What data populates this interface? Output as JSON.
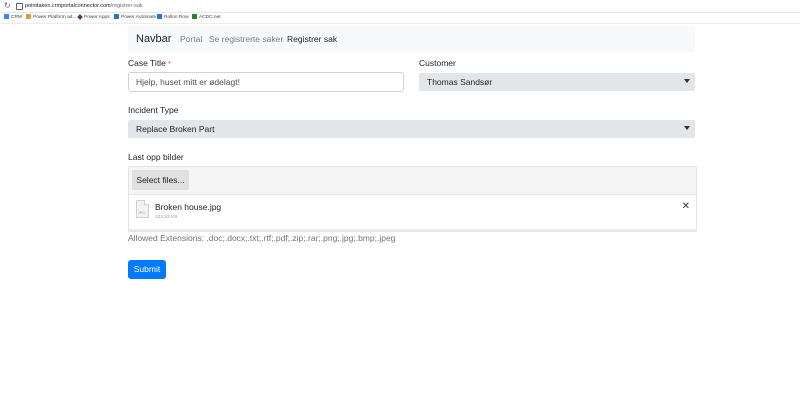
{
  "browser": {
    "url_host": "pointtaken.crmportalconnector.com",
    "url_path": "/registrer-sak",
    "bookmarks": [
      {
        "label": "CRM",
        "color": "#4285f4"
      },
      {
        "label": "Power Platform ad...",
        "color": "#d2a33a"
      },
      {
        "label": "Power Apps",
        "color": "#742774"
      },
      {
        "label": "Power Automate",
        "color": "#2e6fd9"
      },
      {
        "label": "Rollon Row",
        "color": "#2e6fd9"
      },
      {
        "label": "ACDC.net",
        "color": "#2e7d32"
      }
    ]
  },
  "navbar": {
    "brand": "Navbar",
    "links": [
      "Portal",
      "Se registrerte saker",
      "Registrer sak"
    ]
  },
  "form": {
    "case_title": {
      "label": "Case Title",
      "required_mark": "*",
      "value": "Hjelp, huset mitt er ødelagt!"
    },
    "customer": {
      "label": "Customer",
      "value": "Thomas Sandsør"
    },
    "incident_type": {
      "label": "Incident Type",
      "value": "Replace Broken Part"
    },
    "upload": {
      "label": "Last opp bilder",
      "select_button": "Select files...",
      "file_name": "Broken house.jpg",
      "file_size": "323.83 KB",
      "file_ext": "JPG",
      "remove_glyph": "✕"
    },
    "help_text": "Allowed Extensions: .doc;.docx;.txt;.rtf;.pdf;.zip;.rar;.png;.jpg;.bmp;.jpeg",
    "submit_label": "Submit"
  },
  "colors": {
    "primary": "#007bff",
    "required": "#dc3545"
  }
}
